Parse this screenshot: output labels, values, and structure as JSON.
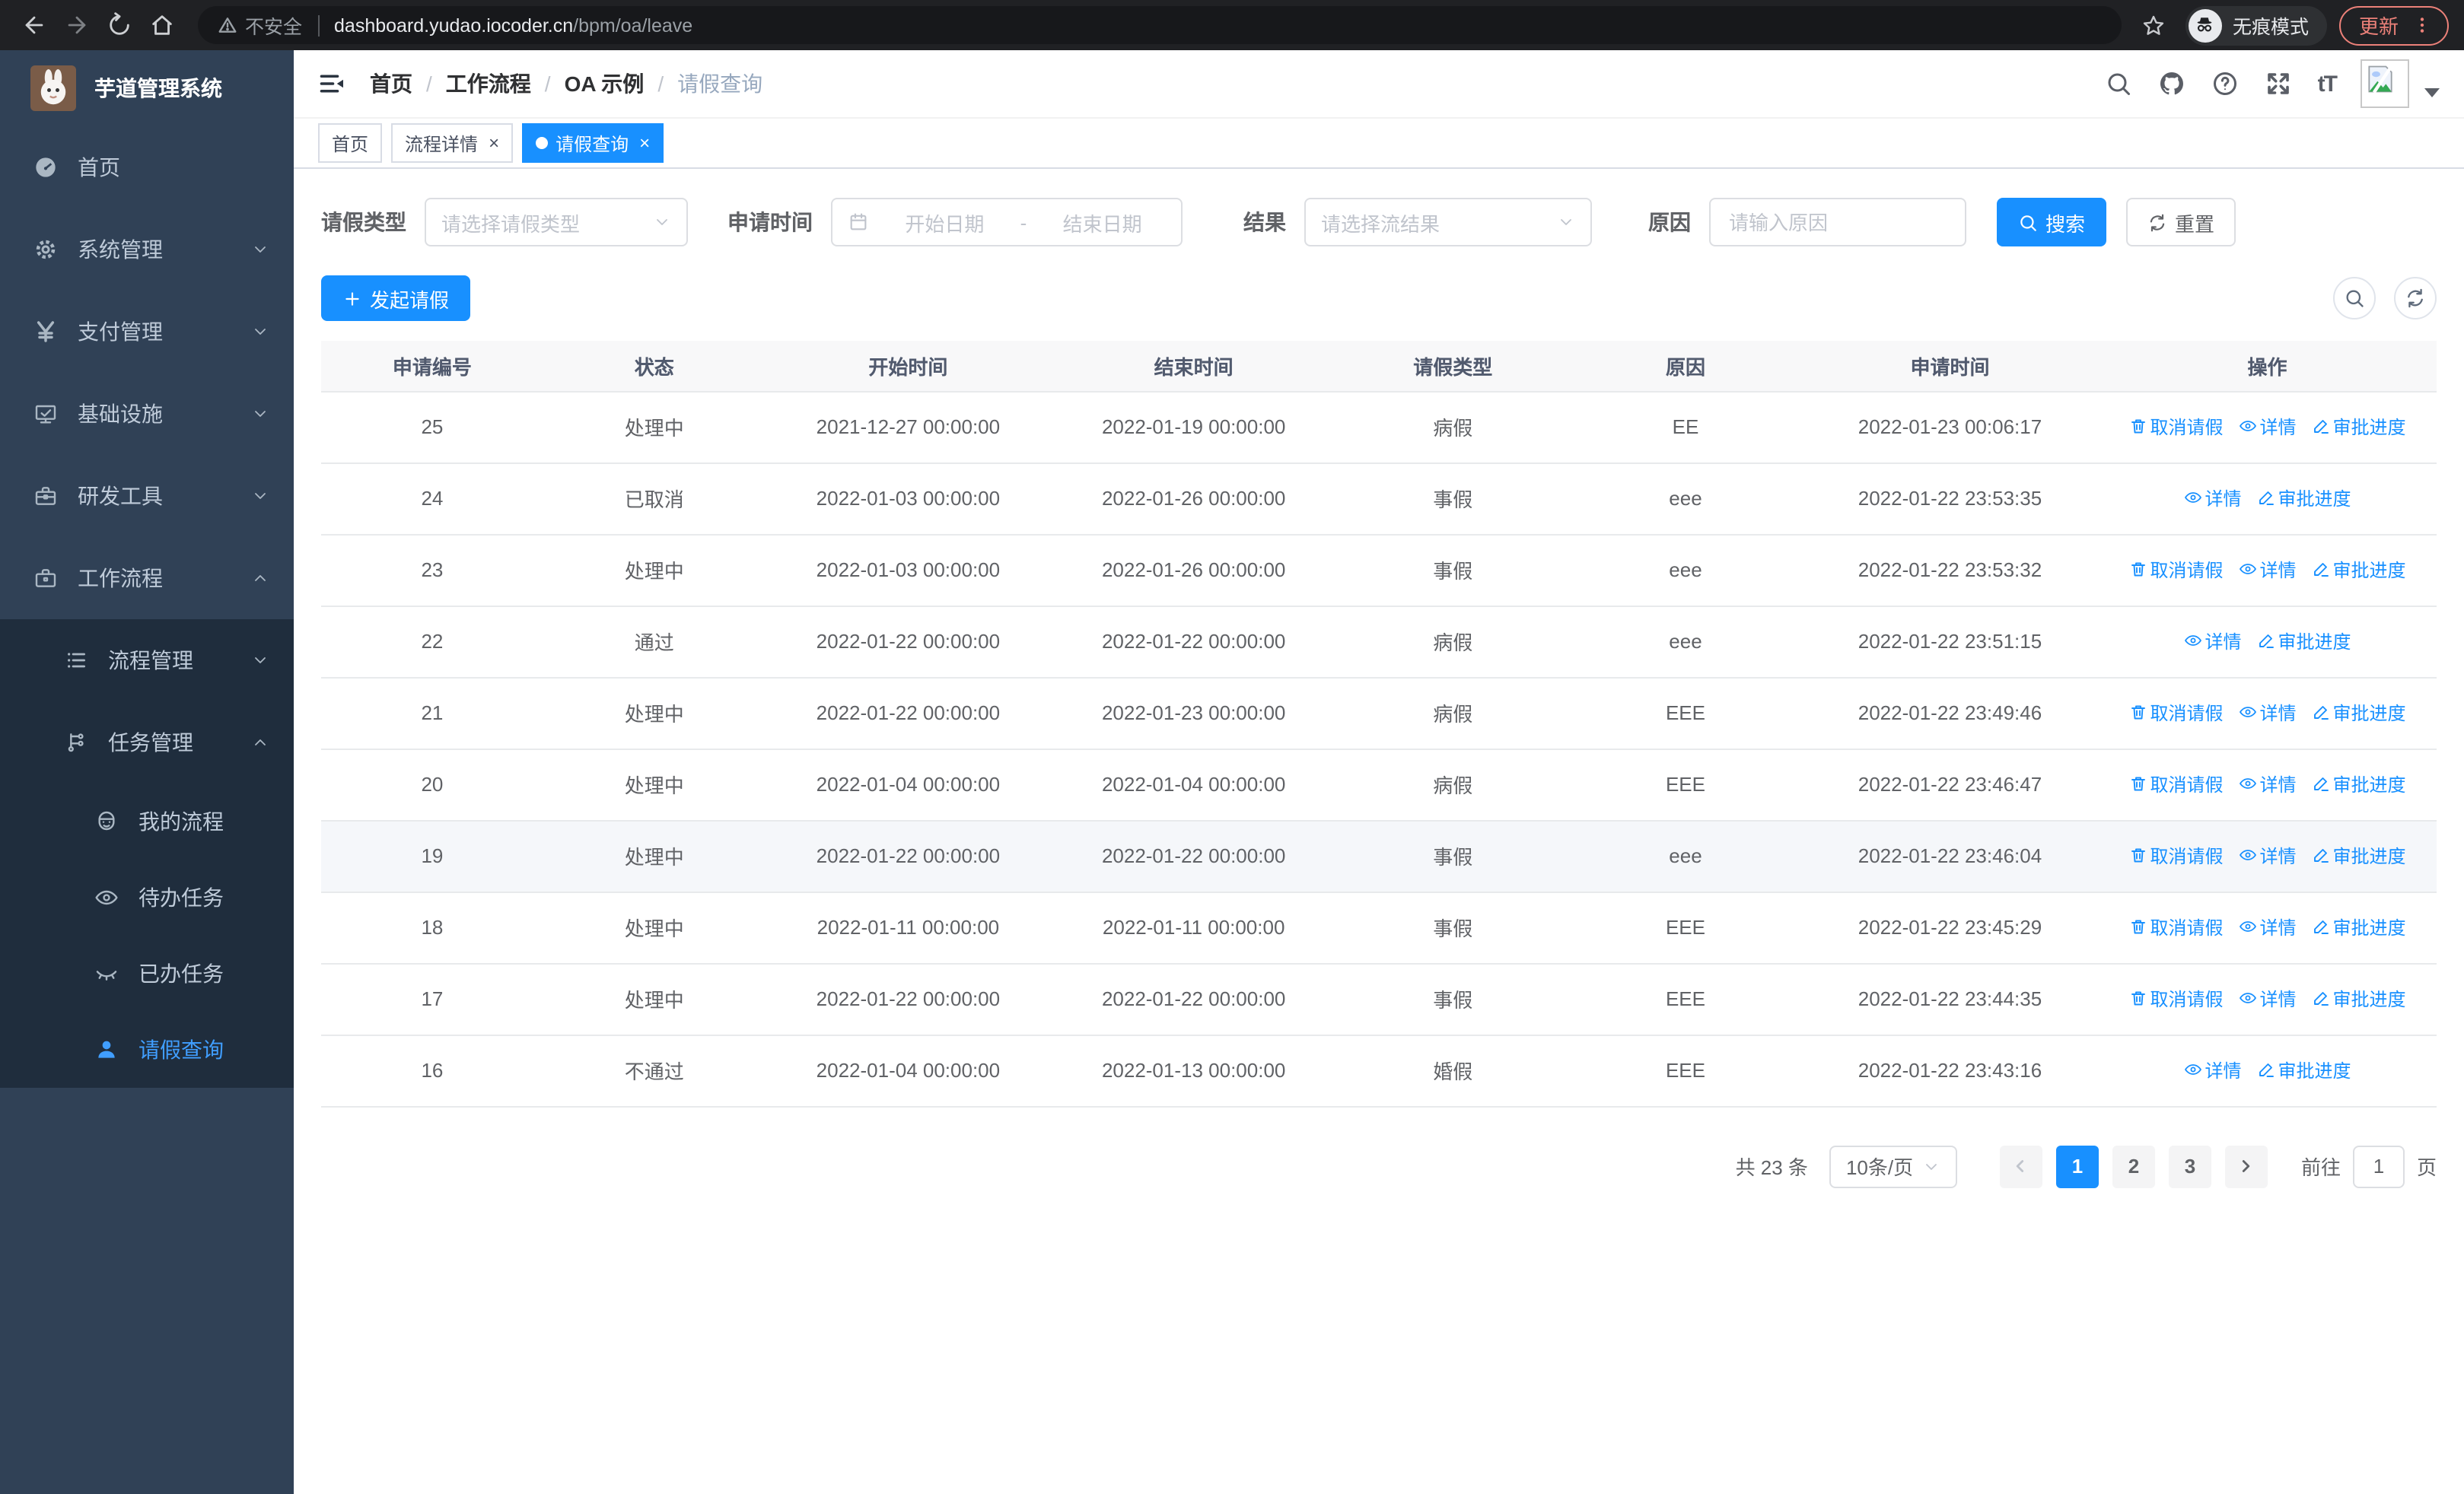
{
  "colors": {
    "accent": "#1890ff",
    "sidebar_bg": "#304156",
    "submenu_bg": "#1f2d3d",
    "sidebar_active": "#409eff",
    "link": "#1890ff",
    "update_pill": "#ec8179"
  },
  "browser": {
    "security_label": "不安全",
    "url_domain": "dashboard.yudao.iocoder.cn",
    "url_path": "/bpm/oa/leave",
    "incognito_label": "无痕模式",
    "update_label": "更新"
  },
  "app": {
    "title": "芋道管理系统"
  },
  "header": {
    "font_size_glyph": "tT"
  },
  "breadcrumb": [
    "首页",
    "工作流程",
    "OA 示例",
    "请假查询"
  ],
  "tabs": [
    {
      "name": "home",
      "label": "首页",
      "closable": false,
      "active": false
    },
    {
      "name": "process-detail",
      "label": "流程详情",
      "closable": true,
      "active": false
    },
    {
      "name": "leave-query",
      "label": "请假查询",
      "closable": true,
      "active": true
    }
  ],
  "sidebar": {
    "items": [
      {
        "name": "home",
        "label": "首页",
        "icon": "dashboard-icon"
      },
      {
        "name": "system",
        "label": "系统管理",
        "icon": "gear-icon",
        "chevron": "down"
      },
      {
        "name": "payment",
        "label": "支付管理",
        "icon": "yen-icon",
        "chevron": "down"
      },
      {
        "name": "infrastructure",
        "label": "基础设施",
        "icon": "monitor-icon",
        "chevron": "down"
      },
      {
        "name": "dev-tools",
        "label": "研发工具",
        "icon": "toolbox-icon",
        "chevron": "down"
      },
      {
        "name": "workflow",
        "label": "工作流程",
        "icon": "briefcase-icon",
        "chevron": "up",
        "expanded": true,
        "children": [
          {
            "name": "process-mgmt",
            "label": "流程管理",
            "icon": "list-icon",
            "chevron": "down"
          },
          {
            "name": "task-mgmt",
            "label": "任务管理",
            "icon": "flow-icon",
            "chevron": "up",
            "expanded": true,
            "children": [
              {
                "name": "my-process",
                "label": "我的流程",
                "icon": "robot-icon"
              },
              {
                "name": "todo-tasks",
                "label": "待办任务",
                "icon": "eye-icon"
              },
              {
                "name": "done-tasks",
                "label": "已办任务",
                "icon": "eye-closed-icon"
              },
              {
                "name": "leave-query",
                "label": "请假查询",
                "icon": "user-icon",
                "active": true
              }
            ]
          }
        ]
      }
    ]
  },
  "filters": {
    "leave_type": {
      "label": "请假类型",
      "placeholder": "请选择请假类型"
    },
    "apply_time": {
      "label": "申请时间",
      "start_placeholder": "开始日期",
      "separator": "-",
      "end_placeholder": "结束日期"
    },
    "result": {
      "label": "结果",
      "placeholder": "请选择流结果"
    },
    "reason": {
      "label": "原因",
      "placeholder": "请输入原因"
    },
    "search_label": "搜索",
    "reset_label": "重置"
  },
  "toolbar": {
    "create_label": "发起请假"
  },
  "table": {
    "columns": [
      "申请编号",
      "状态",
      "开始时间",
      "结束时间",
      "请假类型",
      "原因",
      "申请时间",
      "操作"
    ],
    "action_labels": {
      "cancel": "取消请假",
      "detail": "详情",
      "progress": "审批进度"
    },
    "rows": [
      {
        "id": "25",
        "status": "处理中",
        "start": "2021-12-27 00:00:00",
        "end": "2022-01-19 00:00:00",
        "type": "病假",
        "reason": "EE",
        "applied": "2022-01-23 00:06:17",
        "actions": [
          "cancel",
          "detail",
          "progress"
        ]
      },
      {
        "id": "24",
        "status": "已取消",
        "start": "2022-01-03 00:00:00",
        "end": "2022-01-26 00:00:00",
        "type": "事假",
        "reason": "eee",
        "applied": "2022-01-22 23:53:35",
        "actions": [
          "detail",
          "progress"
        ]
      },
      {
        "id": "23",
        "status": "处理中",
        "start": "2022-01-03 00:00:00",
        "end": "2022-01-26 00:00:00",
        "type": "事假",
        "reason": "eee",
        "applied": "2022-01-22 23:53:32",
        "actions": [
          "cancel",
          "detail",
          "progress"
        ]
      },
      {
        "id": "22",
        "status": "通过",
        "start": "2022-01-22 00:00:00",
        "end": "2022-01-22 00:00:00",
        "type": "病假",
        "reason": "eee",
        "applied": "2022-01-22 23:51:15",
        "actions": [
          "detail",
          "progress"
        ]
      },
      {
        "id": "21",
        "status": "处理中",
        "start": "2022-01-22 00:00:00",
        "end": "2022-01-23 00:00:00",
        "type": "病假",
        "reason": "EEE",
        "applied": "2022-01-22 23:49:46",
        "actions": [
          "cancel",
          "detail",
          "progress"
        ]
      },
      {
        "id": "20",
        "status": "处理中",
        "start": "2022-01-04 00:00:00",
        "end": "2022-01-04 00:00:00",
        "type": "病假",
        "reason": "EEE",
        "applied": "2022-01-22 23:46:47",
        "actions": [
          "cancel",
          "detail",
          "progress"
        ]
      },
      {
        "id": "19",
        "status": "处理中",
        "start": "2022-01-22 00:00:00",
        "end": "2022-01-22 00:00:00",
        "type": "事假",
        "reason": "eee",
        "applied": "2022-01-22 23:46:04",
        "actions": [
          "cancel",
          "detail",
          "progress"
        ],
        "highlight": true
      },
      {
        "id": "18",
        "status": "处理中",
        "start": "2022-01-11 00:00:00",
        "end": "2022-01-11 00:00:00",
        "type": "事假",
        "reason": "EEE",
        "applied": "2022-01-22 23:45:29",
        "actions": [
          "cancel",
          "detail",
          "progress"
        ]
      },
      {
        "id": "17",
        "status": "处理中",
        "start": "2022-01-22 00:00:00",
        "end": "2022-01-22 00:00:00",
        "type": "事假",
        "reason": "EEE",
        "applied": "2022-01-22 23:44:35",
        "actions": [
          "cancel",
          "detail",
          "progress"
        ]
      },
      {
        "id": "16",
        "status": "不通过",
        "start": "2022-01-04 00:00:00",
        "end": "2022-01-13 00:00:00",
        "type": "婚假",
        "reason": "EEE",
        "applied": "2022-01-22 23:43:16",
        "actions": [
          "detail",
          "progress"
        ]
      }
    ]
  },
  "pagination": {
    "total_label": "共 23 条",
    "page_size_label": "10条/页",
    "pages": [
      "1",
      "2",
      "3"
    ],
    "active_page": "1",
    "goto_label": "前往",
    "goto_value": "1",
    "page_suffix_label": "页"
  }
}
